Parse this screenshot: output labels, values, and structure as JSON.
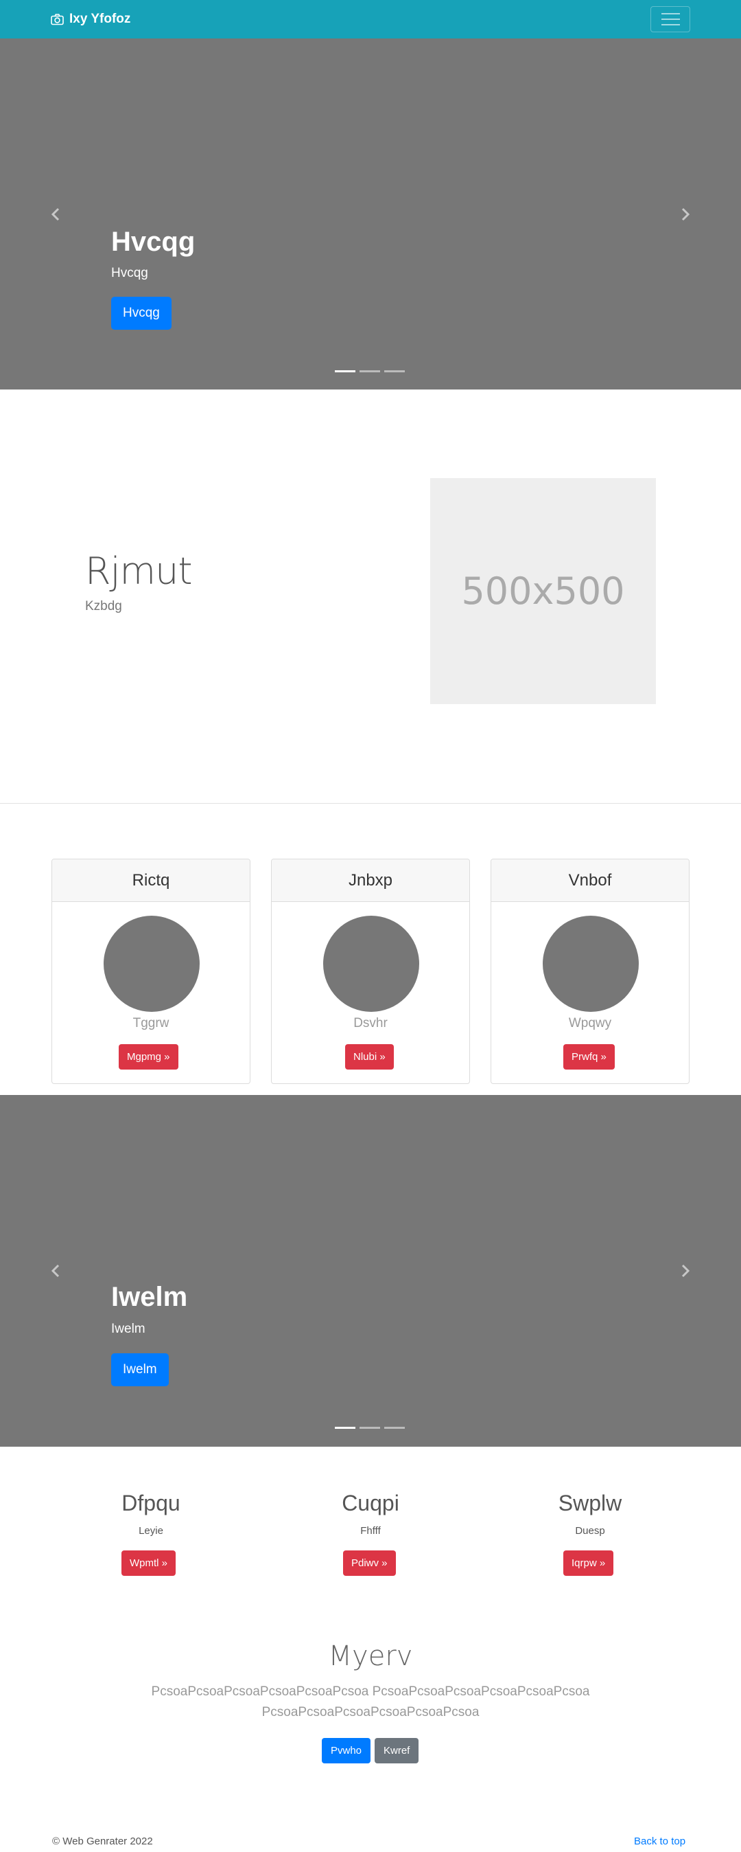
{
  "navbar": {
    "brand": "Ixy Yfofoz",
    "brand_icon": "camera-icon",
    "toggler_icon": "hamburger-icon",
    "bg_color": "#17a2b8"
  },
  "hero": {
    "title": "Hvcqg",
    "subtitle": "Hvcqg",
    "button": "Hvcqg",
    "slides": 3,
    "active_slide": 1
  },
  "feature": {
    "title": "Rjmut",
    "subtitle": "Kzbdg",
    "placeholder_label": "500x500"
  },
  "cards": [
    {
      "header": "Rictq",
      "subtitle": "Tggrw",
      "button": "Mgpmg »"
    },
    {
      "header": "Jnbxp",
      "subtitle": "Dsvhr",
      "button": "Nlubi »"
    },
    {
      "header": "Vnbof",
      "subtitle": "Wpqwy",
      "button": "Prwfq »"
    }
  ],
  "carousel2": {
    "title": "Iwelm",
    "subtitle": "Iwelm",
    "button": "Iwelm",
    "slides": 3,
    "active_slide": 1
  },
  "columns": [
    {
      "title": "Dfpqu",
      "subtitle": "Leyie",
      "button": "Wpmtl »"
    },
    {
      "title": "Cuqpi",
      "subtitle": "Fhfff",
      "button": "Pdiwv »"
    },
    {
      "title": "Swplw",
      "subtitle": "Duesp",
      "button": "Iqrpw »"
    }
  ],
  "jumbotron": {
    "title": "Myerv",
    "text": "PcsoaPcsoaPcsoaPcsoaPcsoaPcsoa PcsoaPcsoaPcsoaPcsoaPcsoaPcsoaPcsoaPcsoaPcsoaPcsoaPcsoaPcsoa",
    "primary_button": "Pvwho",
    "secondary_button": "Kwref"
  },
  "footer": {
    "copyright": "© Web Genrater 2022",
    "back_to_top": "Back to top"
  },
  "colors": {
    "primary": "#007bff",
    "danger": "#dc3545",
    "secondary": "#6c757d",
    "carousel_bg": "#777777"
  }
}
